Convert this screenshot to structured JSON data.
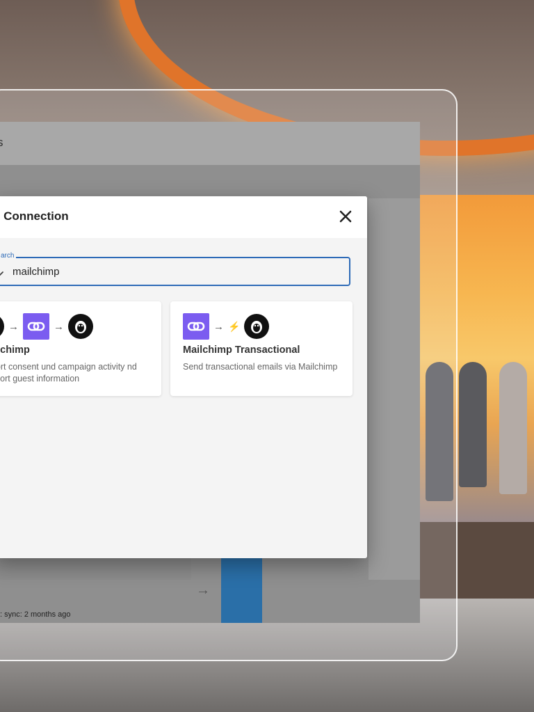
{
  "app": {
    "header_title": "s",
    "last_sync": ": sync: 2 months ago"
  },
  "modal": {
    "title": "d Connection",
    "search_label": "arch",
    "search_value": "mailchimp"
  },
  "cards": [
    {
      "title": "lailchimp",
      "description": "nport consent und campaign activity nd export guest information",
      "flow": [
        "mailchimp-icon",
        "arrow-right-icon",
        "link-icon",
        "arrow-right-icon",
        "mailchimp-icon"
      ]
    },
    {
      "title": "Mailchimp Transactional",
      "description": "Send transactional emails via Mailchimp",
      "flow": [
        "link-icon",
        "arrow-right-icon",
        "bolt-icon",
        "mailchimp-icon"
      ]
    }
  ],
  "colors": {
    "accent": "#2d6ab7",
    "link_icon_bg": "#7b5cf0",
    "blue_bar": "#2a6fa8"
  }
}
